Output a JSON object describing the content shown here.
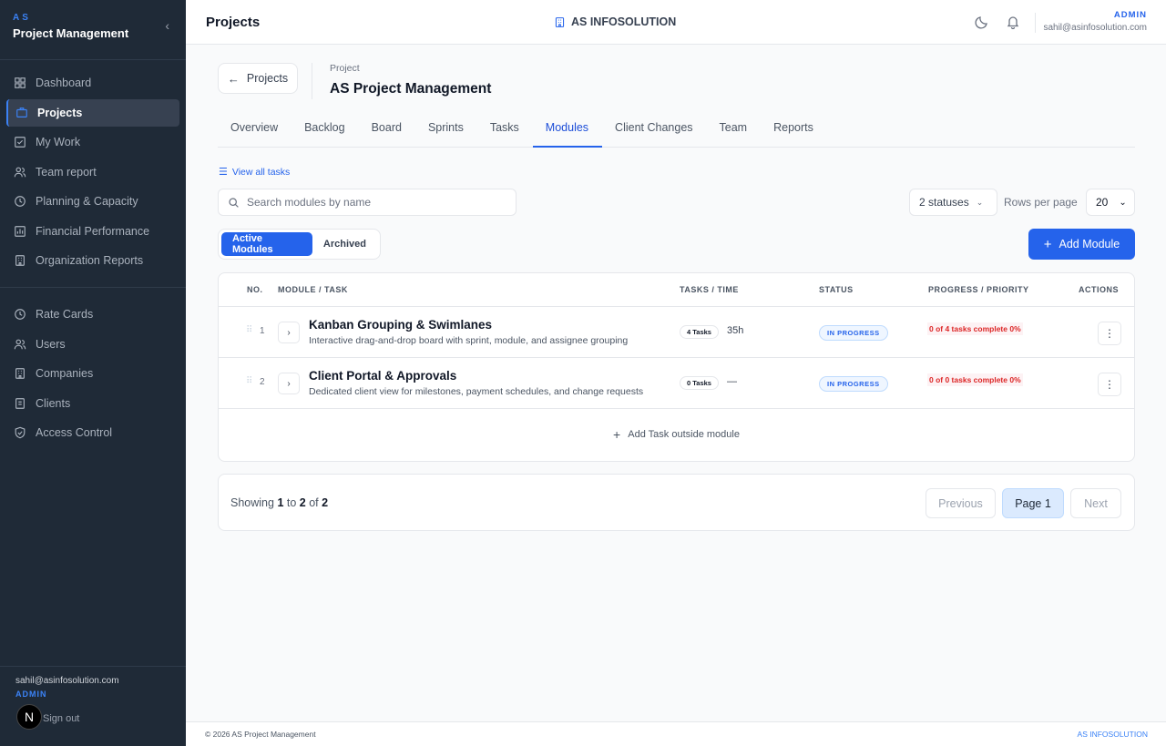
{
  "sidebar": {
    "brand_small": "AS",
    "brand_title": "Project Management",
    "collapse_icon": "chevron-left-icon",
    "primary_items": [
      {
        "label": "Dashboard",
        "icon": "dashboard-grid-icon"
      },
      {
        "label": "Projects",
        "icon": "briefcase-icon",
        "active": true
      },
      {
        "label": "My Work",
        "icon": "check-square-icon"
      },
      {
        "label": "Team report",
        "icon": "users-icon"
      },
      {
        "label": "Planning & Capacity",
        "icon": "clock-icon"
      },
      {
        "label": "Financial Performance",
        "icon": "chart-icon"
      },
      {
        "label": "Organization Reports",
        "icon": "building-icon"
      }
    ],
    "secondary_items": [
      {
        "label": "Rate Cards",
        "icon": "clock-icon"
      },
      {
        "label": "Users",
        "icon": "users-icon"
      },
      {
        "label": "Companies",
        "icon": "building-icon"
      },
      {
        "label": "Clients",
        "icon": "document-icon"
      },
      {
        "label": "Access Control",
        "icon": "shield-icon"
      }
    ],
    "footer": {
      "email": "sahil@asinfosolution.com",
      "role": "ADMIN",
      "sign_out": "Sign out",
      "avatar": "N"
    }
  },
  "topbar": {
    "title": "Projects",
    "org": "AS INFOSOLUTION",
    "role": "ADMIN",
    "email": "sahil@asinfosolution.com"
  },
  "project": {
    "back_label": "Projects",
    "label": "Project",
    "name": "AS Project Management"
  },
  "tabs": [
    "Overview",
    "Backlog",
    "Board",
    "Sprints",
    "Tasks",
    "Modules",
    "Client Changes",
    "Team",
    "Reports"
  ],
  "active_tab": "Modules",
  "toolbar": {
    "view_all": "View all tasks",
    "search_placeholder": "Search modules by name",
    "status_filter": "2 statuses",
    "rows_per_page_label": "Rows per page",
    "rows_per_page": "20",
    "seg_active": "Active Modules",
    "seg_archived": "Archived",
    "add_module": "Add Module"
  },
  "table": {
    "headers": {
      "no": "NO.",
      "module": "MODULE / TASK",
      "tasks_time": "TASKS / TIME",
      "status": "STATUS",
      "progress": "PROGRESS / PRIORITY",
      "actions": "ACTIONS"
    },
    "rows": [
      {
        "no": "1",
        "title": "Kanban Grouping & Swimlanes",
        "desc": "Interactive drag-and-drop board with sprint, module, and assignee grouping",
        "tasks": "4 Tasks",
        "time": "35h",
        "status": "IN PROGRESS",
        "progress": "0 of 4 tasks complete  0%"
      },
      {
        "no": "2",
        "title": "Client Portal & Approvals",
        "desc": "Dedicated client view for milestones, payment schedules, and change requests",
        "tasks": "0 Tasks",
        "time": "—",
        "status": "IN PROGRESS",
        "progress": "0 of 0 tasks complete  0%"
      }
    ],
    "add_task_outside": "Add Task outside module"
  },
  "pagination": {
    "showing_prefix": "Showing",
    "from": "1",
    "to_word": "to",
    "to": "2",
    "of_word": "of",
    "total": "2",
    "previous": "Previous",
    "page": "Page 1",
    "next": "Next"
  },
  "footer": {
    "copyright": "© 2026 AS Project Management",
    "brand": "AS INFOSOLUTION"
  },
  "colors": {
    "sidebar_bg": "#1f2a37",
    "accent": "#2563eb",
    "danger": "#dc2626"
  }
}
